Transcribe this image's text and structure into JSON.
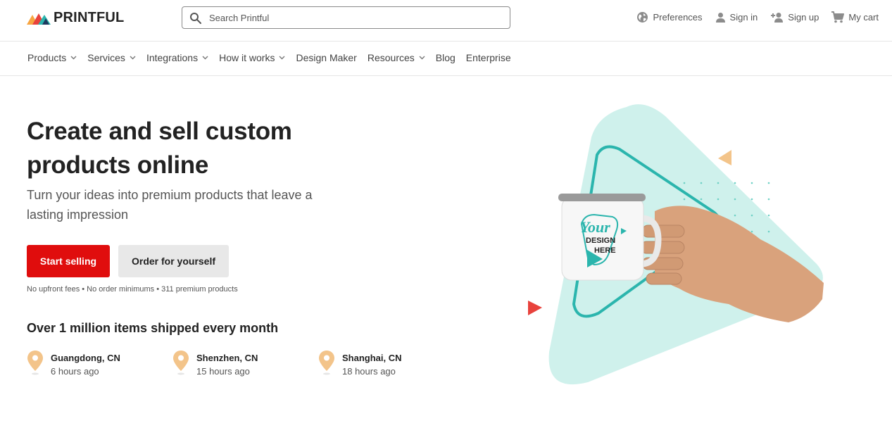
{
  "brand": {
    "name": "PRINTFUL"
  },
  "search": {
    "placeholder": "Search Printful"
  },
  "top_actions": {
    "preferences": "Preferences",
    "sign_in": "Sign in",
    "sign_up": "Sign up",
    "cart": "My cart"
  },
  "nav": [
    {
      "label": "Products",
      "dropdown": true
    },
    {
      "label": "Services",
      "dropdown": true
    },
    {
      "label": "Integrations",
      "dropdown": true
    },
    {
      "label": "How it works",
      "dropdown": true
    },
    {
      "label": "Design Maker",
      "dropdown": false
    },
    {
      "label": "Resources",
      "dropdown": true
    },
    {
      "label": "Blog",
      "dropdown": false
    },
    {
      "label": "Enterprise",
      "dropdown": false
    }
  ],
  "hero": {
    "title": "Create and sell custom products online",
    "subtitle": "Turn your ideas into premium products that leave a lasting impression",
    "primary_cta": "Start selling",
    "secondary_cta": "Order for yourself",
    "fine_print": "No upfront fees • No order minimums • 311 premium products"
  },
  "shipping": {
    "title": "Over 1 million items shipped every month",
    "locations": [
      {
        "city": "Guangdong, CN",
        "time": "6 hours ago"
      },
      {
        "city": "Shenzhen, CN",
        "time": "15 hours ago"
      },
      {
        "city": "Shanghai, CN",
        "time": "18 hours ago"
      }
    ]
  },
  "mug_print": {
    "line1": "Your",
    "line2": "DESIGN",
    "line3": "HERE"
  },
  "colors": {
    "accent_red": "#e00d0d",
    "mint": "#cff1ec",
    "teal": "#2bb5ad",
    "pin": "#f3c48a"
  },
  "icons": [
    "search-icon",
    "globe-icon",
    "user-icon",
    "add-user-icon",
    "cart-icon",
    "chevron-down-icon",
    "location-pin-icon"
  ]
}
